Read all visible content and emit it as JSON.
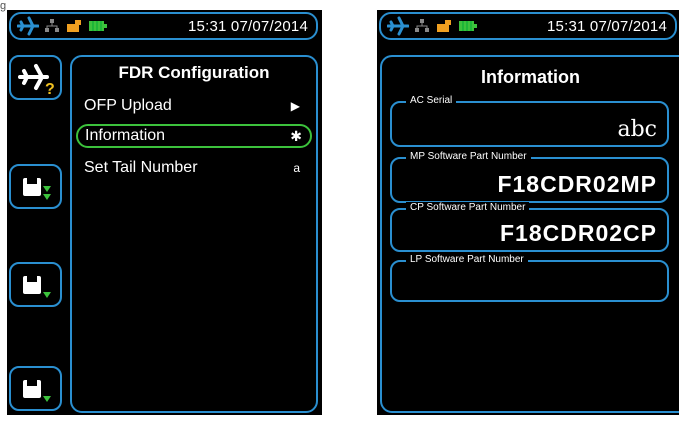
{
  "left_screen": {
    "status_bar": {
      "time": "15:31 07/07/2014"
    },
    "panel": {
      "title": "FDR Configuration",
      "menu": [
        {
          "label": "OFP Upload",
          "right": "▶",
          "selected": false
        },
        {
          "label": "Information",
          "right": "✱",
          "selected": true
        },
        {
          "label": "Set Tail Number",
          "right": "a",
          "selected": false
        }
      ]
    },
    "side_buttons": [
      {
        "icon": "plane-question-icon",
        "badge": "?"
      },
      {
        "icon": "floppy-download-icon"
      },
      {
        "icon": "floppy-arrow-icon"
      },
      {
        "icon": "floppy-arrow-icon"
      }
    ]
  },
  "right_screen": {
    "status_bar": {
      "time": "15:31 07/07/2014"
    },
    "panel": {
      "title": "Information",
      "fields": [
        {
          "label": "AC Serial",
          "value": "abc"
        },
        {
          "label": "MP Software Part Number",
          "value": "F18CDR02MP"
        },
        {
          "label": "CP Software Part Number",
          "value": "F18CDR02CP"
        },
        {
          "label": "LP Software Part Number",
          "value": ""
        }
      ]
    }
  },
  "colors": {
    "frame": "#2a8fd0",
    "selected": "#3cc23c",
    "battery": "#3cc23c",
    "usb": "#f0a020",
    "badge": "#f0c020"
  }
}
